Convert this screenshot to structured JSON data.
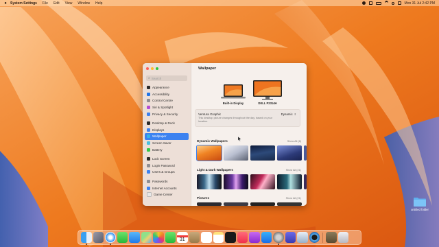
{
  "menubar": {
    "app_name": "System Settings",
    "menus": [
      "File",
      "Edit",
      "View",
      "Window",
      "Help"
    ],
    "clock": "Mon 31 Jul  2:42 PM",
    "status_icons": [
      "record-icon",
      "control-center-icon",
      "battery-icon",
      "wifi-icon",
      "search-icon",
      "screen-icon"
    ]
  },
  "window": {
    "search_placeholder": "Search",
    "sidebar": [
      {
        "label": "Appearance",
        "icon": "appearance-icon",
        "color": "#2a2a2a"
      },
      {
        "label": "Accessibility",
        "icon": "accessibility-icon",
        "color": "#1f74e8"
      },
      {
        "label": "Control Centre",
        "icon": "control-centre-icon",
        "color": "#8e8e93"
      },
      {
        "label": "Siri & Spotlight",
        "icon": "siri-icon",
        "color": "#b34bd6"
      },
      {
        "label": "Privacy & Security",
        "icon": "privacy-icon",
        "color": "#3d82f0"
      },
      {
        "label": "Desktop & Dock",
        "icon": "desktop-dock-icon",
        "color": "#2a2a2a",
        "gap": true
      },
      {
        "label": "Displays",
        "icon": "displays-icon",
        "color": "#3d82f0"
      },
      {
        "label": "Wallpaper",
        "icon": "wallpaper-icon",
        "color": "#36b5e8",
        "active": true
      },
      {
        "label": "Screen Saver",
        "icon": "screen-saver-icon",
        "color": "#4ac0e0"
      },
      {
        "label": "Battery",
        "icon": "battery-icon",
        "color": "#33c748"
      },
      {
        "label": "Lock Screen",
        "icon": "lock-screen-icon",
        "color": "#2a2a2a",
        "gap": true
      },
      {
        "label": "Login Password",
        "icon": "login-password-icon",
        "color": "#8e8e93"
      },
      {
        "label": "Users & Groups",
        "icon": "users-groups-icon",
        "color": "#3d82f0"
      },
      {
        "label": "Passwords",
        "icon": "passwords-icon",
        "color": "#8e8e93",
        "gap": true
      },
      {
        "label": "Internet Accounts",
        "icon": "internet-accounts-icon",
        "color": "#3d82f0"
      },
      {
        "label": "Game Center",
        "icon": "game-center-icon",
        "color": "#e8e8e8"
      }
    ],
    "main": {
      "title": "Wallpaper",
      "displays": [
        {
          "label": "Built-in Display",
          "icon": "laptop-icon"
        },
        {
          "label": "DELL P2314H",
          "icon": "monitor-icon"
        }
      ],
      "selector": {
        "name": "Ventura Graphic",
        "description": "This desktop picture changes throughout the day, based on your location.",
        "mode": "Dynamic"
      },
      "sections": [
        {
          "title": "Dynamic Wallpapers",
          "show_all": "Show All (8)"
        },
        {
          "title": "Light & Dark Wallpapers",
          "show_all": "Show All (21)"
        },
        {
          "title": "Pictures",
          "show_all": "Show All (21)"
        }
      ]
    }
  },
  "dock": {
    "apps": [
      "finder-icon",
      "launchpad-icon",
      "safari-icon",
      "messages-icon",
      "mail-icon",
      "maps-icon",
      "photos-icon",
      "facetime-icon",
      "calendar-icon",
      "contacts-icon",
      "reminders-icon",
      "notes-icon",
      "tv-icon",
      "music-icon",
      "podcasts-icon",
      "app-store-icon",
      "system-settings-icon",
      "star-icon",
      "preview-icon",
      "quicktime-icon",
      "downloads-stack-icon",
      "trash-icon"
    ],
    "calendar_day": "31"
  },
  "desktop": {
    "folder_label": "untitled folder"
  }
}
